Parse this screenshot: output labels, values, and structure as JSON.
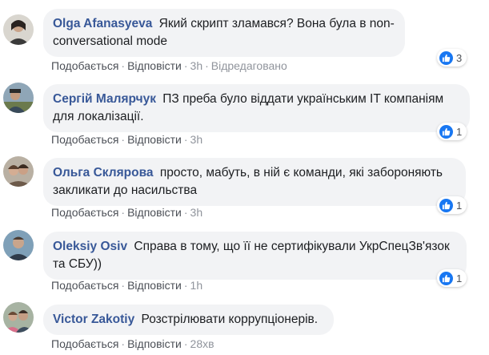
{
  "actions": {
    "like": "Подобається",
    "reply": "Відповісти",
    "dot": "·"
  },
  "comments": [
    {
      "author": "Olga Afanasyeva",
      "text": "Який скрипт зламався? Вона була в non-conversational mode",
      "time": "3h",
      "edited": "Відредаговано",
      "reactions": "3"
    },
    {
      "author": "Сергій Малярчук",
      "text": "ПЗ преба було віддати українським IT компаніям для локалізації.",
      "time": "3h",
      "reactions": "1"
    },
    {
      "author": "Ольга Склярова",
      "text": "просто, мабуть, в ній є команди, які забороняють закликати до насильства",
      "time": "3h",
      "reactions": "1"
    },
    {
      "author": "Oleksiy Osiv",
      "text": "Справа в тому, що її не сертифікували УкрСпецЗв'язок та СБУ))",
      "time": "1h",
      "reactions": "1"
    },
    {
      "author": "Victor Zakotiy",
      "text": "Розстрілювати коррупціонерів.",
      "time": "28хв"
    }
  ],
  "colors": {
    "author": "#385898",
    "bubble": "#f2f3f5",
    "like_blue": "#1877f2",
    "meta": "#90949c"
  },
  "icons": {
    "reaction": "like-thumb-icon"
  }
}
